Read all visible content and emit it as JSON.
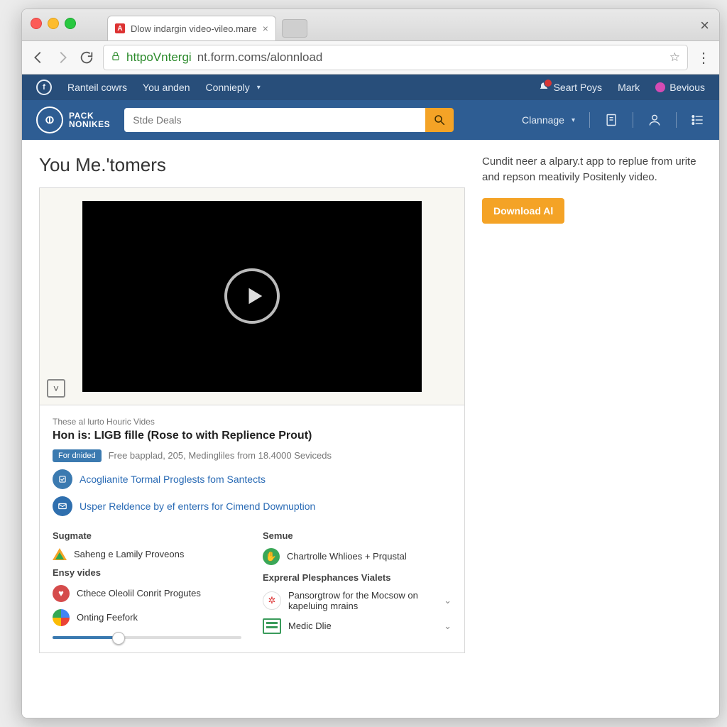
{
  "browser": {
    "tab_title": "Dlow indargin video-vileo.mare",
    "url_secure": "httpoVntergi",
    "url_rest": "nt.form.coms/alonnload"
  },
  "topnav": {
    "items": [
      "Ranteil cowrs",
      "You anden",
      "Connieply"
    ],
    "right": {
      "notif": "Seart Poys",
      "mark": "Mark",
      "bevious": "Bevious"
    }
  },
  "brand": {
    "line1": "PACK",
    "line2": "NONIKES"
  },
  "search": {
    "placeholder": "Stde Deals"
  },
  "header_right": {
    "language": "Clannage"
  },
  "page_title": "You Me.'tomers",
  "sidebar": {
    "blurb": "Cundit neer a alpary.t app to replue from urite and repson meativily Positenly video.",
    "cta": "Download Al"
  },
  "video": {
    "crumb": "These al lurto Houric Vides",
    "title": "Hon is: LIGB fille (Rose to with Replience Prout)",
    "pill": "For dnided",
    "subtitle": "Free bapplad, 205, Medingliles from 18.4000 Seviceds",
    "links": [
      "Acoglianite Tormal Proglests fom Santects",
      "Usper Reldence by ef enterrs for Cimend Downuption"
    ]
  },
  "cols": {
    "left": {
      "h1": "Sugmate",
      "i1": "Saheng e Lamily Proveons",
      "h2": "Ensy vides",
      "i2": "Cthece Oleolil Conrit Progutes",
      "i3": "Onting Feefork"
    },
    "right": {
      "h1": "Semue",
      "i1": "Chartrolle Whlioes + Prqustal",
      "h2": "Expreral Plesphances Vialets",
      "i2": "Pansorgtrow for the Mocsow on kapeluing mrains",
      "i3": "Medic Dlie"
    }
  }
}
